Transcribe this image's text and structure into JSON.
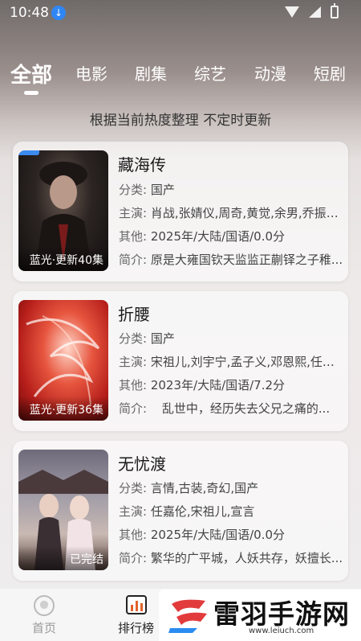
{
  "status_bar": {
    "time": "10:48",
    "download_icon": "download-icon",
    "icons": [
      "wifi-icon",
      "signal-icon",
      "battery-icon"
    ]
  },
  "tabs": [
    {
      "label": "全部",
      "active": true
    },
    {
      "label": "电影"
    },
    {
      "label": "剧集"
    },
    {
      "label": "综艺"
    },
    {
      "label": "动漫"
    },
    {
      "label": "短剧"
    }
  ],
  "subtitle": "根据当前热度整理 不定时更新",
  "items": [
    {
      "title": "藏海传",
      "badge": "蓝光·更新40集",
      "category_key": "分类:",
      "category": "国产",
      "cast_key": "主演:",
      "cast": "肖战,张婧仪,周奇,黄觉,余男,乔振宇...",
      "other_key": "其他:",
      "other": "2025年/大陆/国语/0.0分",
      "intro_key": "简介:",
      "intro": "原是大雍国钦天监监正蒯铎之子稚..."
    },
    {
      "title": "折腰",
      "badge": "蓝光·更新36集",
      "category_key": "分类:",
      "category": "国产",
      "cast_key": "主演:",
      "cast": "宋祖儿,刘宇宁,孟子义,邓恩熙,任豪,...",
      "other_key": "其他:",
      "other": "2023年/大陆/国语/7.2分",
      "intro_key": "简介:",
      "intro": "乱世中，经历失去父兄之痛的..."
    },
    {
      "title": "无忧渡",
      "badge": "已完结",
      "category_key": "分类:",
      "category": "言情,古装,奇幻,国产",
      "cast_key": "主演:",
      "cast": "任嘉伦,宋祖儿,宣言",
      "other_key": "其他:",
      "other": "2025年/大陆/国语/0.0分",
      "intro_key": "简介:",
      "intro": "繁华的广平城，人妖共存，妖擅长..."
    }
  ],
  "bottom_nav": [
    {
      "label": "首页",
      "icon": "home-icon"
    },
    {
      "label": "排行榜",
      "icon": "ranking-icon",
      "active": true
    }
  ],
  "watermark": {
    "text": "雷羽手游网",
    "url": "www.leiuch.com",
    "logo": "leiyu-logo"
  },
  "colors": {
    "accent": "#e2622a",
    "badge_blue": "#2f86f6"
  }
}
